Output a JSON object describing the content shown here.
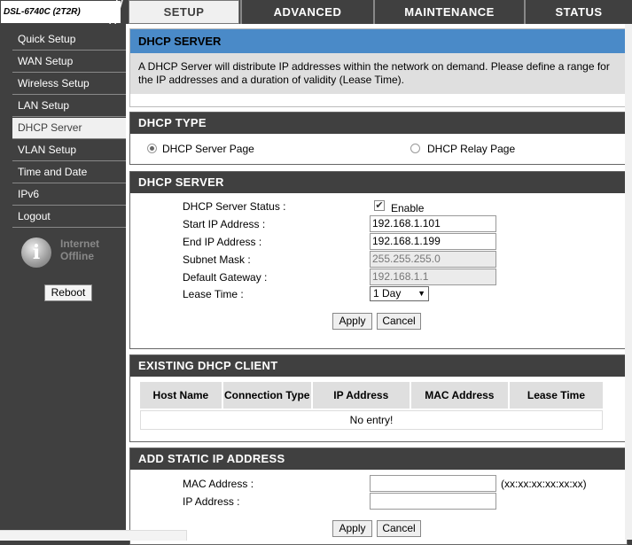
{
  "header": {
    "model": "DSL-6740C (2T2R)",
    "tabs": [
      {
        "label": "SETUP",
        "active": true
      },
      {
        "label": "ADVANCED",
        "active": false
      },
      {
        "label": "MAINTENANCE",
        "active": false
      },
      {
        "label": "STATUS",
        "active": false
      }
    ]
  },
  "sidebar": {
    "items": [
      {
        "label": "Quick Setup"
      },
      {
        "label": "WAN Setup"
      },
      {
        "label": "Wireless Setup"
      },
      {
        "label": "LAN Setup"
      },
      {
        "label": "DHCP Server",
        "active": true
      },
      {
        "label": "VLAN Setup"
      },
      {
        "label": "Time and Date"
      },
      {
        "label": "IPv6"
      },
      {
        "label": "Logout"
      }
    ],
    "internet_status_line1": "Internet",
    "internet_status_line2": "Offline",
    "reboot_label": "Reboot"
  },
  "intro": {
    "title": "DHCP SERVER",
    "text": "A DHCP Server will distribute IP addresses within the network on demand. Please define a range for the IP addresses and a duration of validity (Lease Time)."
  },
  "dhcp_type": {
    "title": "DHCP TYPE",
    "option_server": "DHCP Server Page",
    "option_relay": "DHCP Relay Page"
  },
  "dhcp_server": {
    "title": "DHCP SERVER",
    "status_label": "DHCP Server Status :",
    "enable_label": "Enable",
    "enable_checked": "✔",
    "start_label": "Start IP Address :",
    "start_value": "192.168.1.101",
    "end_label": "End IP Address :",
    "end_value": "192.168.1.199",
    "mask_label": "Subnet Mask :",
    "mask_value": "255.255.255.0",
    "gateway_label": "Default Gateway :",
    "gateway_value": "192.168.1.1",
    "lease_label": "Lease Time :",
    "lease_value": "1 Day",
    "apply_label": "Apply",
    "cancel_label": "Cancel"
  },
  "clients": {
    "title": "EXISTING DHCP CLIENT",
    "col_host": "Host Name",
    "col_conn": "Connection Type",
    "col_ip": "IP Address",
    "col_mac": "MAC Address",
    "col_lease": "Lease Time",
    "empty": "No entry!"
  },
  "static_ip": {
    "title": "ADD STATIC IP ADDRESS",
    "mac_label": "MAC Address :",
    "mac_hint": "(xx:xx:xx:xx:xx:xx)",
    "ip_label": "IP Address :",
    "apply_label": "Apply",
    "cancel_label": "Cancel"
  },
  "colors": {
    "nav_bg": "#404040",
    "header_blue": "#4a8ac8",
    "intro_bg": "#dfdfdf"
  }
}
